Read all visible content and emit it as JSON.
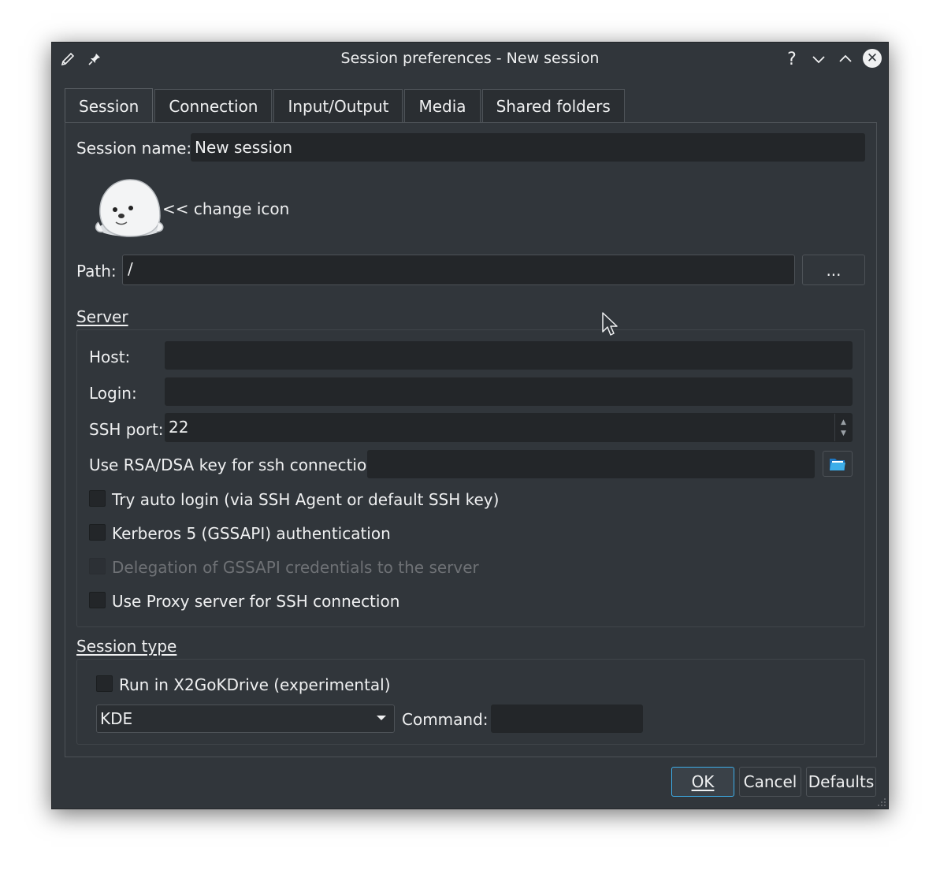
{
  "window": {
    "title": "Session preferences - New session",
    "help_glyph": "?",
    "minimize_glyph": "⌄",
    "maximize_glyph": "⌃",
    "close_glyph": "✕"
  },
  "tabs": [
    {
      "label": "Session",
      "active": true
    },
    {
      "label": "Connection",
      "active": false
    },
    {
      "label": "Input/Output",
      "active": false
    },
    {
      "label": "Media",
      "active": false
    },
    {
      "label": "Shared folders",
      "active": false
    }
  ],
  "session": {
    "name_label": "Session name:",
    "name_value": "New session",
    "change_icon_label": "<< change icon",
    "path_label": "Path:",
    "path_value": "/",
    "browse_label": "..."
  },
  "server": {
    "group_label": "Server",
    "host_label": "Host:",
    "host_value": "",
    "login_label": "Login:",
    "login_value": "",
    "ssh_port_label": "SSH port:",
    "ssh_port_value": "22",
    "rsa_label": "Use RSA/DSA key for ssh connection:",
    "rsa_value": "",
    "checkboxes": [
      {
        "label": "Try auto login (via SSH Agent or default SSH key)",
        "checked": false,
        "enabled": true
      },
      {
        "label": "Kerberos 5 (GSSAPI) authentication",
        "checked": false,
        "enabled": true
      },
      {
        "label": "Delegation of GSSAPI credentials to the server",
        "checked": false,
        "enabled": false
      },
      {
        "label": "Use Proxy server for SSH connection",
        "checked": false,
        "enabled": true
      }
    ]
  },
  "session_type": {
    "group_label": "Session type",
    "kdrive_label": "Run in X2GoKDrive (experimental)",
    "kdrive_checked": false,
    "type_value": "KDE",
    "command_label": "Command:",
    "command_value": ""
  },
  "buttons": {
    "ok": "OK",
    "cancel": "Cancel",
    "defaults": "Defaults"
  },
  "colors": {
    "window_bg": "#31363b",
    "field_bg": "#232629",
    "accent": "#3daee9",
    "text": "#eff0f1"
  }
}
